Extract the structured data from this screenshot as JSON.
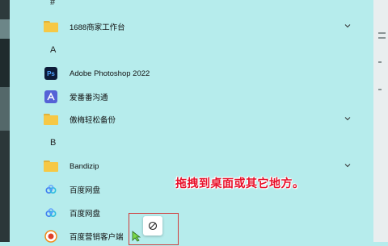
{
  "sections": [
    {
      "letter": "#"
    },
    {
      "letter": "A"
    },
    {
      "letter": "B"
    }
  ],
  "items": [
    {
      "label": "1688商家工作台",
      "icon": "folder-icon",
      "expandable": true
    },
    {
      "label": "Adobe Photoshop 2022",
      "icon": "photoshop-icon",
      "icon_text": "Ps"
    },
    {
      "label": "爱番番沟通",
      "icon": "aifanfan-icon"
    },
    {
      "label": "傲梅轻松备份",
      "icon": "folder-icon",
      "expandable": true
    },
    {
      "label": "Bandizip",
      "icon": "folder-icon",
      "expandable": true
    },
    {
      "label": "百度网盘",
      "icon": "baidu-netdisk-icon"
    },
    {
      "label": "百度网盘",
      "icon": "baidu-netdisk-icon"
    },
    {
      "label": "百度营销客户端",
      "icon": "baidu-marketing-icon"
    }
  ],
  "annotation": {
    "text": "拖拽到桌面或其它地方。"
  },
  "drag": {
    "cursor_icon": "not-allowed-icon"
  },
  "colors": {
    "background": "#b6ecec",
    "annotation": "#e8102a",
    "folder": "#f6c845",
    "highlight_box": "#d03c3c"
  }
}
